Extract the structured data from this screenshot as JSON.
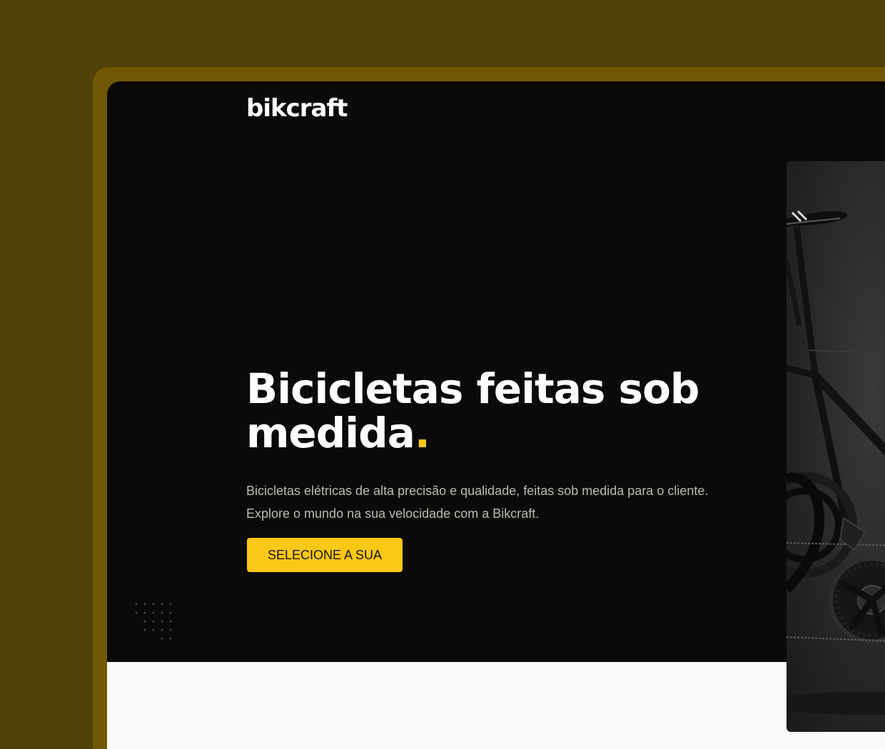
{
  "brand": {
    "logo_text": "bikcraft"
  },
  "hero": {
    "headline": "Bicicletas feitas sob medida",
    "headline_dot": ".",
    "description_line1": "Bicicletas elétricas de alta precisão e qualidade, feitas sob medida para o cliente.",
    "description_line2": "Explore o mundo na sua velocidade com a Bikcraft.",
    "cta_label": "SELECIONE A SUA"
  },
  "colors": {
    "page_background": "#514209",
    "frame": "#705703",
    "hero_background": "#0b0a09",
    "accent": "#fbc817",
    "body_text": "#bbb9b4",
    "section_background": "#faf9f7"
  },
  "icons": {
    "decoration": "dot-grid-pattern",
    "product": "bicycle-photo"
  }
}
